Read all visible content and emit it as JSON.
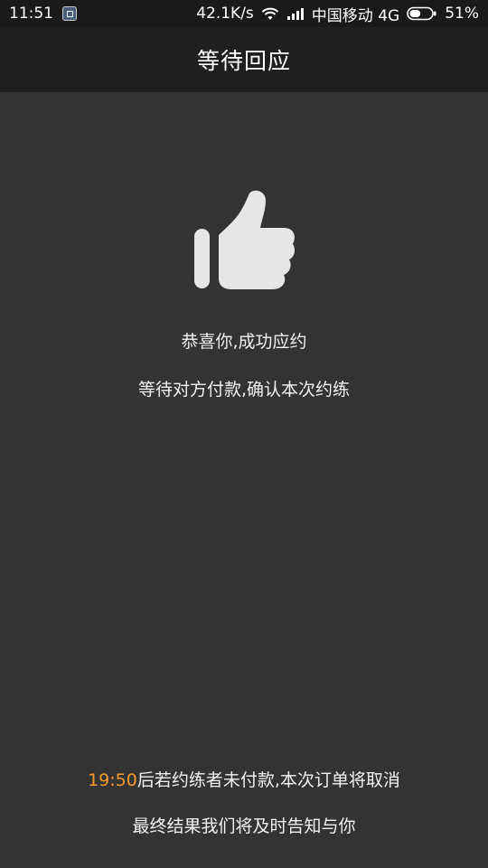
{
  "status_bar": {
    "time": "11:51",
    "network_speed": "42.1K/s",
    "carrier": "中国移动 4G",
    "battery_percent": "51%",
    "battery_level": 0.51,
    "icons": [
      "app-notification-icon",
      "wifi-icon",
      "signal-icon",
      "battery-icon"
    ]
  },
  "header": {
    "title": "等待回应"
  },
  "main": {
    "illustration_icon": "thumbs-up-icon",
    "congrats_text": "恭喜你,成功应约",
    "waiting_text": "等待对方付款,确认本次约练"
  },
  "footer": {
    "countdown": "19:50",
    "cancel_notice": "后若约练者未付款,本次订单将取消",
    "result_notice": "最终结果我们将及时告知与你"
  },
  "colors": {
    "background": "#333333",
    "title_bar": "#1f1f1f",
    "status_bar": "#1a1a1a",
    "accent_countdown": "#f39a2e",
    "icon": "#e6e6e6"
  }
}
